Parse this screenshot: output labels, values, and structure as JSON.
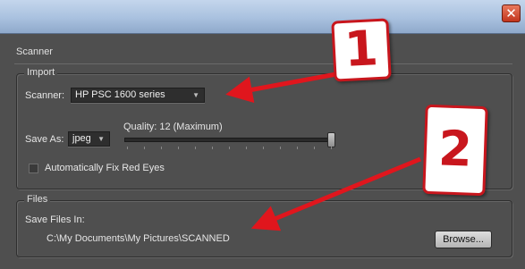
{
  "window": {
    "close_glyph": "✕"
  },
  "dialog": {
    "section_title": "Scanner",
    "import": {
      "legend": "Import",
      "scanner_label": "Scanner:",
      "scanner_value": "HP PSC 1600 series",
      "save_as_label": "Save As:",
      "save_as_value": "jpeg",
      "quality_label": "Quality: 12 (Maximum)",
      "quality_value": 12,
      "quality_max": 12,
      "red_eye_label": "Automatically Fix Red Eyes",
      "red_eye_checked": false
    },
    "files": {
      "legend": "Files",
      "save_in_label": "Save Files In:",
      "save_in_path": "C:\\My Documents\\My Pictures\\SCANNED",
      "browse_label": "Browse..."
    }
  },
  "callouts": [
    {
      "number": "1",
      "color": "#c8161d"
    },
    {
      "number": "2",
      "color": "#c8161d"
    }
  ],
  "icons": {
    "close": "close-icon",
    "dropdown": "chevron-down-icon"
  }
}
